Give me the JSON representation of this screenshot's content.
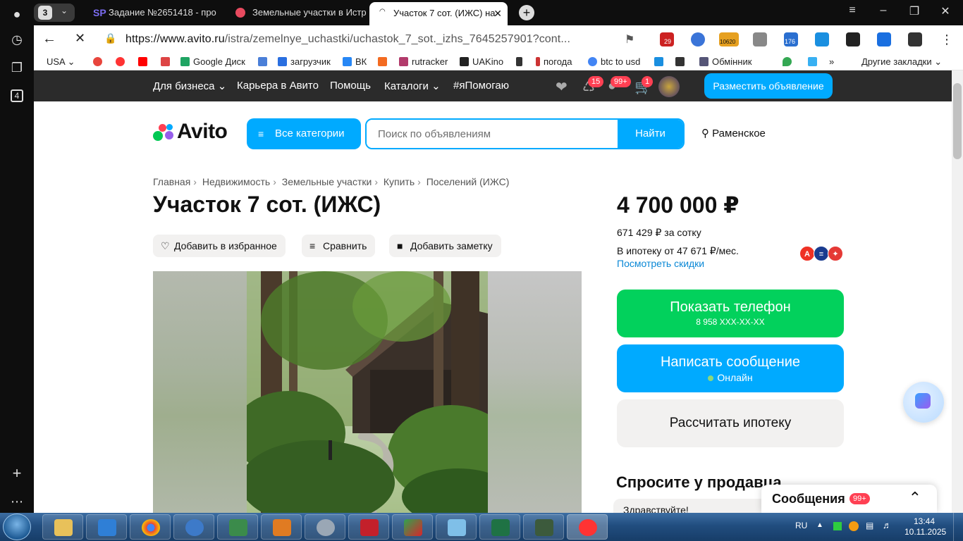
{
  "browser": {
    "tab_count": "3",
    "tabs": [
      {
        "label": "Задание №2651418 - про",
        "favicon": "SP"
      },
      {
        "label": "Земельные участки в Истр"
      },
      {
        "label": "Участок 7 сот. (ИЖС) на"
      }
    ],
    "sidebar_badge": "4",
    "url_domain": "https://www.avito.ru",
    "url_path": "/istra/zemelnye_uchastki/uchastok_7_sot._izhs_7645257901?cont...",
    "extension_badges": [
      "29",
      "10620",
      "176"
    ],
    "bookmarks": [
      "USA",
      "Google Диск",
      "загрузчик",
      "ВК",
      "rutracker",
      "UAKino",
      "погода",
      "btc to usd",
      "Обмінник"
    ],
    "other_bookmarks": "Другие закладки"
  },
  "topnav": {
    "items": [
      "Для бизнеса",
      "Карьера в Авито",
      "Помощь",
      "Каталоги",
      "#яПомогаю"
    ],
    "badge_notifications": "15",
    "badge_messages": "99+",
    "badge_cart": "1",
    "post_button": "Разместить объявление"
  },
  "header": {
    "logo": "Avito",
    "all_categories": "Все категории",
    "search_placeholder": "Поиск по объявлениям",
    "search_button": "Найти",
    "location": "Раменское"
  },
  "breadcrumbs": [
    "Главная",
    "Недвижимость",
    "Земельные участки",
    "Купить",
    "Поселений (ИЖС)"
  ],
  "listing": {
    "title": "Участок 7 сот. (ИЖС)",
    "actions": {
      "favorite": "Добавить в избранное",
      "compare": "Сравнить",
      "note": "Добавить заметку"
    },
    "price": "4 700 000 ₽",
    "price_per_sotka": "671 429 ₽ за сотку",
    "mortgage": "В ипотеку от 47 671 ₽/мес.",
    "discounts_link": "Посмотреть скидки",
    "show_phone": "Показать телефон",
    "phone_mask": "8 958 XXX-XX-XX",
    "write_message": "Написать сообщение",
    "online_status": "Онлайн",
    "calc_mortgage": "Рассчитать ипотеку",
    "ask_seller": "Спросите у продавца",
    "hello_chip": "Здравствуйте!"
  },
  "messages_widget": {
    "title": "Сообщения",
    "badge": "99+"
  },
  "taskbar": {
    "lang": "RU",
    "time": "13:44",
    "date": "10.11.2025"
  },
  "colors": {
    "avito_blue": "#00aaff",
    "avito_green": "#02d15c",
    "badge_red": "#ff4053",
    "nav_dark": "#2b2b2b"
  }
}
